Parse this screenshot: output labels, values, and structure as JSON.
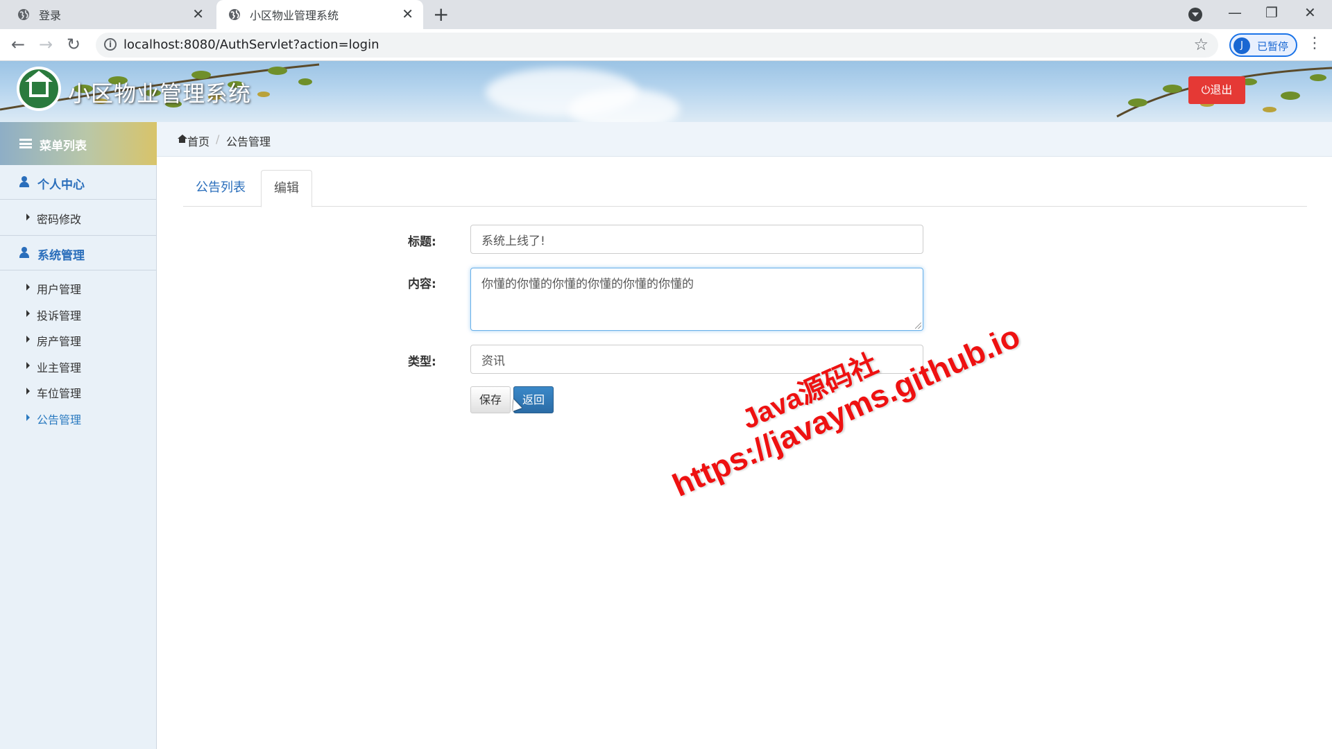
{
  "browser": {
    "tabs": [
      {
        "title": "登录"
      },
      {
        "title": "小区物业管理系统"
      }
    ],
    "url": "localhost:8080/AuthServlet?action=login",
    "profile": {
      "initial": "J",
      "label": "已暂停"
    }
  },
  "app": {
    "system_name": "小区物业管理系统",
    "logout_label": "退出"
  },
  "sidebar": {
    "header": "菜单列表",
    "groups": [
      {
        "title": "个人中心",
        "items": [
          "密码修改"
        ]
      },
      {
        "title": "系统管理",
        "items": [
          "用户管理",
          "投诉管理",
          "房产管理",
          "业主管理",
          "车位管理",
          "公告管理"
        ]
      }
    ],
    "active_item": "公告管理"
  },
  "breadcrumb": {
    "home": "首页",
    "current": "公告管理"
  },
  "content_tabs": [
    {
      "label": "公告列表",
      "active": false
    },
    {
      "label": "编辑",
      "active": true
    }
  ],
  "form": {
    "title_label": "标题:",
    "title_value": "系统上线了!",
    "content_label": "内容:",
    "content_value": "你懂的你懂的你懂的你懂的你懂的你懂的",
    "type_label": "类型:",
    "type_value": "资讯",
    "save_label": "保存",
    "back_label": "返回"
  },
  "watermark": {
    "line1": "Java源码社",
    "line2": "https://javayms.github.io"
  },
  "colors": {
    "accent": "#2a6ebb",
    "logout": "#e53935",
    "back_button": "#2b6ca6",
    "watermark": "#ee1111"
  }
}
